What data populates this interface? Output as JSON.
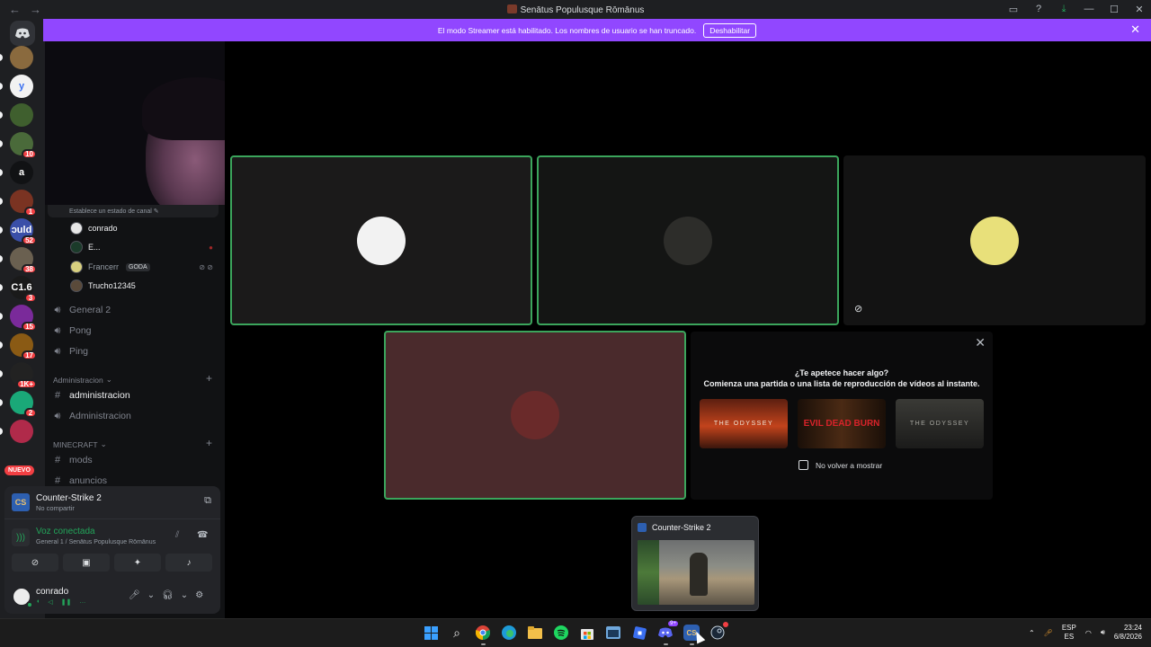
{
  "window": {
    "title": "Senātus Populusque Rōmānus",
    "nav_back": "←",
    "nav_forward": "→"
  },
  "banner": {
    "text": "El modo Streamer está habilitado. Los nombres de usuario se han truncado.",
    "button": "Deshabilitar",
    "close": "✕"
  },
  "rail": {
    "servers": [
      {
        "id": "s1",
        "color": "#8a6a3e",
        "letter": ""
      },
      {
        "id": "s2",
        "color": "#f2f2f2",
        "letter": "y"
      },
      {
        "id": "s3",
        "color": "#3f5f2e",
        "letter": ""
      },
      {
        "id": "s4",
        "color": "#4a6a3a",
        "letter": "",
        "badge": "10"
      },
      {
        "id": "s5",
        "color": "#111214",
        "letter": "a"
      },
      {
        "id": "s6",
        "color": "#7a3322",
        "letter": "",
        "badge": "1"
      },
      {
        "id": "s7",
        "color": "#3a4fa8",
        "letter": "ɔuld",
        "badge": "52"
      },
      {
        "id": "s8",
        "color": "#6a6050",
        "letter": "",
        "badge": "38"
      },
      {
        "id": "s9",
        "color": "#1a1a1a",
        "letter": "C1.6",
        "badge": "3"
      },
      {
        "id": "s10",
        "color": "#7a2a9a",
        "letter": "",
        "badge": "15"
      },
      {
        "id": "s11",
        "color": "#8a5a14",
        "letter": "",
        "badge": "17"
      },
      {
        "id": "s12",
        "color": "#222222",
        "letter": "",
        "badge": "1K+"
      },
      {
        "id": "s13",
        "color": "#1aa878",
        "letter": "",
        "badge": "2"
      },
      {
        "id": "s14",
        "color": "#b02a4a",
        "letter": ""
      }
    ],
    "new_label": "NUEVO"
  },
  "channels": {
    "status_prompt": "Establece un estado de canal ✎",
    "voice_users": [
      {
        "name": "conrado",
        "dim": false,
        "right": ""
      },
      {
        "name": "E...",
        "dim": false,
        "right": "●"
      },
      {
        "name": "Francerr",
        "dim": true,
        "tag": "GODA",
        "right": "⊘ ⊘"
      },
      {
        "name": "Trucho12345",
        "dim": false,
        "right": ""
      }
    ],
    "voice_channels_1": [
      "General 2",
      "Pong",
      "Ping"
    ],
    "category_admin": "Administracion",
    "admin_channels": [
      {
        "name": "administracion",
        "type": "text",
        "active": true
      },
      {
        "name": "Administracion",
        "type": "voice",
        "active": false
      }
    ],
    "category_minecraft": "MINECRAFT",
    "minecraft_channels": [
      {
        "name": "mods",
        "type": "text"
      },
      {
        "name": "anuncios",
        "type": "text"
      }
    ]
  },
  "activity": {
    "game": "Counter-Strike 2",
    "sub": "No compartir"
  },
  "voice": {
    "status": "Voz conectada",
    "location": "General 1 / Senātus Populusque Rōmānus"
  },
  "user": {
    "name": "conrado"
  },
  "stage": {
    "tiles": [
      {
        "id": "t1",
        "bg": "#1b1a1a",
        "speaking": true,
        "avatar_color": "#f2f2f2"
      },
      {
        "id": "t2",
        "bg": "#141514",
        "speaking": true,
        "avatar_color": "#2d2d2a"
      },
      {
        "id": "t3",
        "bg": "#131313",
        "speaking": false,
        "avatar_color": "#e8e07a",
        "muted": true
      },
      {
        "id": "t4",
        "bg": "#4a2a2c",
        "speaking": true,
        "avatar_color": "#6a2a2a"
      }
    ]
  },
  "suggest": {
    "title": "¿Te apetece hacer algo?",
    "subtitle": "Comienza una partida o una lista de reproducción de vídeos al instante.",
    "thumbs": [
      "THE ODYSSEY",
      "EVIL DEAD BURN",
      "THE ODYSSEY"
    ],
    "checkbox_label": "No volver a mostrar"
  },
  "preview": {
    "title": "Counter-Strike 2"
  },
  "taskbar": {
    "lang_top": "ESP",
    "lang_bottom": "ES",
    "time": "23:24",
    "date": "6/8/2026",
    "discord_badge": "9+"
  }
}
